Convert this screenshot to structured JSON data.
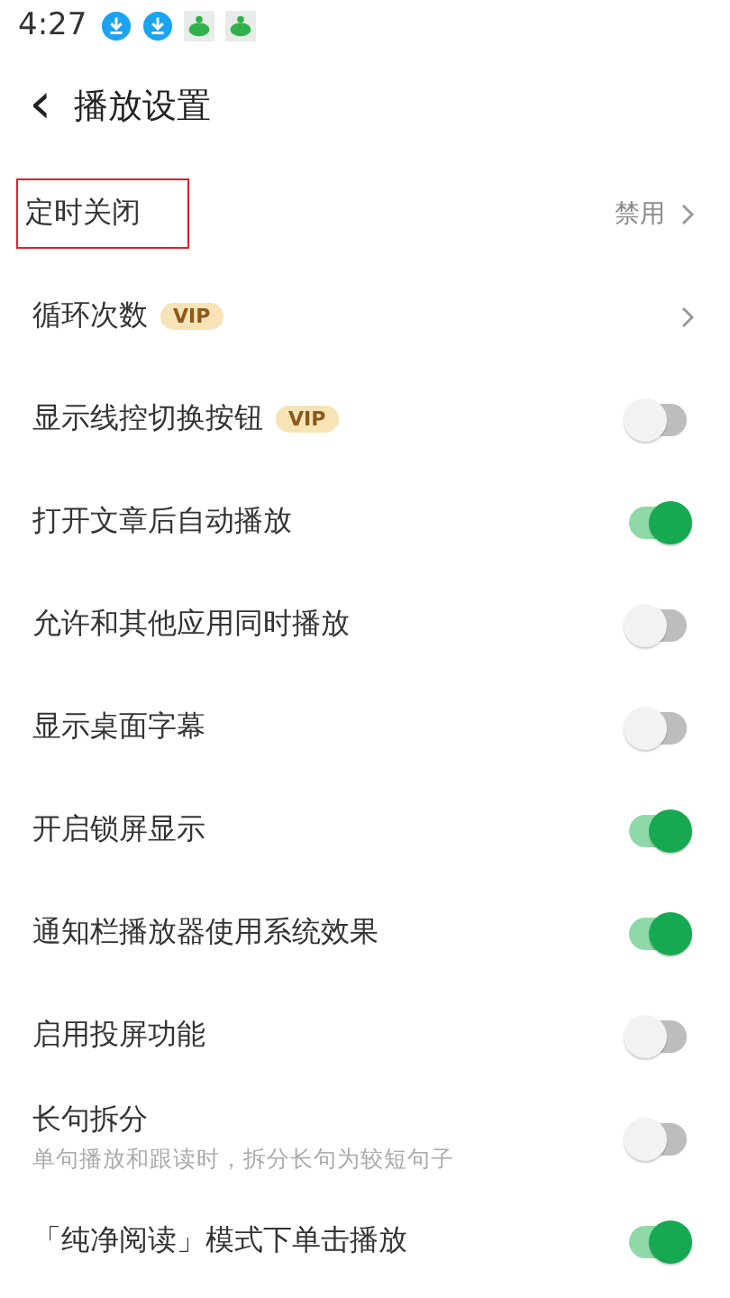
{
  "status_bar": {
    "time": "4:27"
  },
  "header": {
    "back": "‹",
    "title": "播放设置"
  },
  "settings": [
    {
      "kind": "link",
      "label": "定时关闭",
      "value": "禁用",
      "highlighted": true
    },
    {
      "kind": "link",
      "label": "循环次数",
      "badge": "VIP",
      "highlighted": false
    },
    {
      "kind": "toggle",
      "label": "显示线控切换按钮",
      "badge": "VIP",
      "on": false
    },
    {
      "kind": "toggle",
      "label": "打开文章后自动播放",
      "on": true
    },
    {
      "kind": "toggle",
      "label": "允许和其他应用同时播放",
      "on": false
    },
    {
      "kind": "toggle",
      "label": "显示桌面字幕",
      "on": false
    },
    {
      "kind": "toggle",
      "label": "开启锁屏显示",
      "on": true
    },
    {
      "kind": "toggle",
      "label": "通知栏播放器使用系统效果",
      "on": true
    },
    {
      "kind": "toggle",
      "label": "启用投屏功能",
      "on": false
    },
    {
      "kind": "toggle",
      "label": "长句拆分",
      "description": "单句播放和跟读时，拆分长句为较短句子",
      "on": false
    },
    {
      "kind": "toggle",
      "label": "「纯净阅读」模式下单击播放",
      "on": true
    }
  ]
}
